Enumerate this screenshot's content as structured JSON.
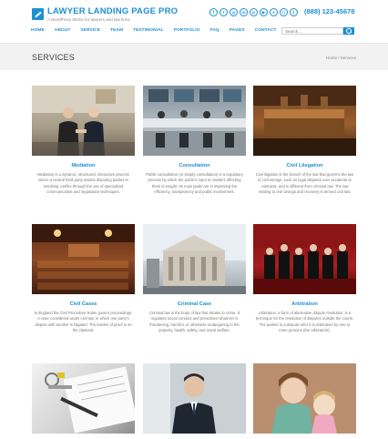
{
  "header": {
    "title": "LAWYER LANDING PAGE PRO",
    "tagline": "A WordPress theme for lawyers and law firms",
    "phone": "(888) 123-45678",
    "socials": [
      "facebook-icon",
      "twitter-icon",
      "google-plus-icon",
      "linkedin-icon",
      "pinterest-icon",
      "youtube-icon",
      "flickr-icon",
      "instagram-icon",
      "rss-icon"
    ]
  },
  "nav": {
    "items": [
      "HOME",
      "ABOUT",
      "SERVICE",
      "TEAM",
      "TESTIMONIAL",
      "PORTFOLIO",
      "FAQ",
      "PAGES",
      "CONTACT"
    ]
  },
  "search": {
    "placeholder": "Search..."
  },
  "page": {
    "title": "SERVICES",
    "breadcrumb": "Home / Services"
  },
  "services": [
    {
      "title": "Mediation",
      "text": "Mediation is a dynamic, structured, interactive process where a neutral third party assists disputing parties in resolving conflict through the use of specialized communication and negotiation techniques."
    },
    {
      "title": "Consultation",
      "text": "Public consultation (or simply consultation) is a regulatory process by which the public's input on matters affecting them is sought. Its main goals are in improving the efficiency, transparency and public involvement."
    },
    {
      "title": "Civil Litegation",
      "text": "Civil litigation is the branch of the law that governs the law of civil wrongs, such as legal disputes over accidents or contracts, and is different from criminal law. The law relating to civil wrongs and recovery is termed civil law."
    },
    {
      "title": "Civil Cases",
      "text": "In England the Civil Procedure Rules govern proceedings. A case considered under civil law, in which one party's dispute with another is litigated. The burden of proof is on the claimant."
    },
    {
      "title": "Criminal Case",
      "text": "Criminal law is the body of law that relates to crime. It regulates social conduct and prescribes whatever is threatening, harmful, or otherwise endangering to the property, health, safety, and moral welfare."
    },
    {
      "title": "Arbitration",
      "text": "Arbitration, a form of alternative dispute resolution, is a technique for the resolution of disputes outside the courts. The parties to a dispute refer it to arbitration by one or more persons (the arbitrators)."
    },
    {
      "title": "",
      "text": ""
    },
    {
      "title": "",
      "text": ""
    },
    {
      "title": "",
      "text": ""
    }
  ]
}
